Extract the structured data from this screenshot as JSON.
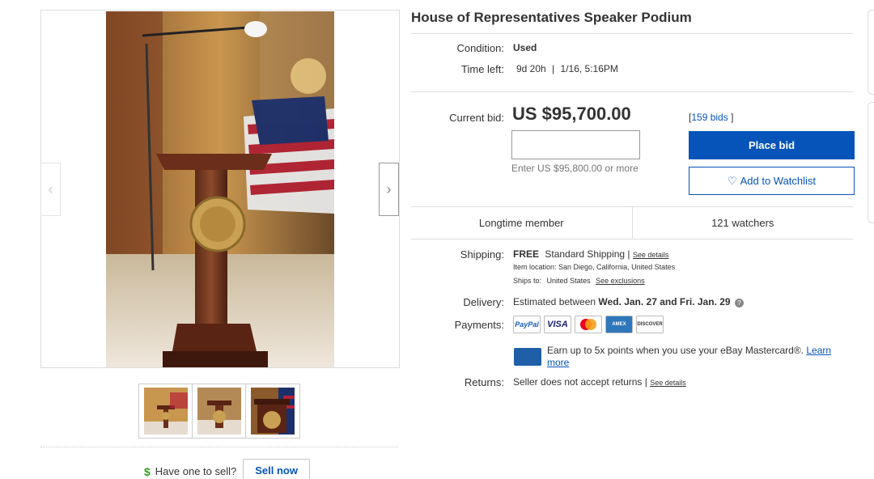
{
  "listing": {
    "title": "House of Representatives Speaker Podium",
    "condition_label": "Condition:",
    "condition_value": "Used",
    "time_left_label": "Time left:",
    "time_left_value": "9d 20h",
    "time_left_sep": "|",
    "end_date": "1/16, 5:16PM"
  },
  "bid": {
    "current_label": "Current bid:",
    "price": "US $95,700.00",
    "input_placeholder": "",
    "hint": "Enter US $95,800.00 or more",
    "bids_open": "[",
    "bids_count": "159 bids",
    "bids_close": "]",
    "place_bid_label": "Place bid",
    "watchlist_label": "Add to Watchlist"
  },
  "seller": {
    "member_label": "Longtime member",
    "watchers": "121 watchers"
  },
  "shipping": {
    "label": "Shipping:",
    "free": "FREE",
    "service": "Standard Shipping |",
    "see_details": "See details",
    "location": "Item location:  San Diego, California, United States",
    "ships_to_label": "Ships to:",
    "ships_to": "United States",
    "see_exclusions": "See exclusions"
  },
  "delivery": {
    "label": "Delivery:",
    "prefix": "Estimated between",
    "window": "Wed. Jan. 27 and Fri. Jan. 29"
  },
  "payments": {
    "label": "Payments:",
    "methods": [
      "PayPal",
      "VISA",
      "Mastercard",
      "AMEX",
      "DISCOVER"
    ]
  },
  "promo": {
    "text": "Earn up to 5x points when you use your eBay Mastercard®.",
    "link": "Learn more"
  },
  "returns": {
    "label": "Returns:",
    "text": "Seller does not accept returns |",
    "see_details": "See details"
  },
  "sell": {
    "prompt": "Have one to sell?",
    "button": "Sell now"
  },
  "colors": {
    "accent": "#0654ba",
    "sell_dollar": "#3a9d23"
  }
}
